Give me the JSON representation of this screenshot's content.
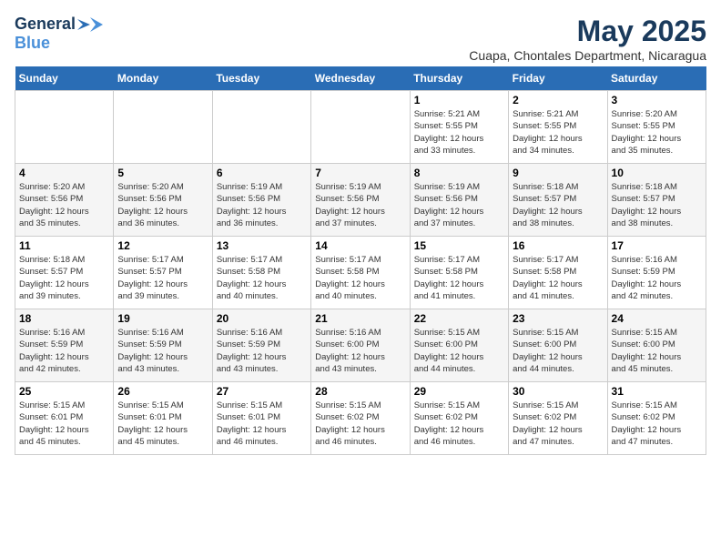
{
  "header": {
    "logo_general": "General",
    "logo_blue": "Blue",
    "month_title": "May 2025",
    "location": "Cuapa, Chontales Department, Nicaragua"
  },
  "days_of_week": [
    "Sunday",
    "Monday",
    "Tuesday",
    "Wednesday",
    "Thursday",
    "Friday",
    "Saturday"
  ],
  "weeks": [
    [
      {
        "day": "",
        "content": ""
      },
      {
        "day": "",
        "content": ""
      },
      {
        "day": "",
        "content": ""
      },
      {
        "day": "",
        "content": ""
      },
      {
        "day": "1",
        "content": "Sunrise: 5:21 AM\nSunset: 5:55 PM\nDaylight: 12 hours\nand 33 minutes."
      },
      {
        "day": "2",
        "content": "Sunrise: 5:21 AM\nSunset: 5:55 PM\nDaylight: 12 hours\nand 34 minutes."
      },
      {
        "day": "3",
        "content": "Sunrise: 5:20 AM\nSunset: 5:55 PM\nDaylight: 12 hours\nand 35 minutes."
      }
    ],
    [
      {
        "day": "4",
        "content": "Sunrise: 5:20 AM\nSunset: 5:56 PM\nDaylight: 12 hours\nand 35 minutes."
      },
      {
        "day": "5",
        "content": "Sunrise: 5:20 AM\nSunset: 5:56 PM\nDaylight: 12 hours\nand 36 minutes."
      },
      {
        "day": "6",
        "content": "Sunrise: 5:19 AM\nSunset: 5:56 PM\nDaylight: 12 hours\nand 36 minutes."
      },
      {
        "day": "7",
        "content": "Sunrise: 5:19 AM\nSunset: 5:56 PM\nDaylight: 12 hours\nand 37 minutes."
      },
      {
        "day": "8",
        "content": "Sunrise: 5:19 AM\nSunset: 5:56 PM\nDaylight: 12 hours\nand 37 minutes."
      },
      {
        "day": "9",
        "content": "Sunrise: 5:18 AM\nSunset: 5:57 PM\nDaylight: 12 hours\nand 38 minutes."
      },
      {
        "day": "10",
        "content": "Sunrise: 5:18 AM\nSunset: 5:57 PM\nDaylight: 12 hours\nand 38 minutes."
      }
    ],
    [
      {
        "day": "11",
        "content": "Sunrise: 5:18 AM\nSunset: 5:57 PM\nDaylight: 12 hours\nand 39 minutes."
      },
      {
        "day": "12",
        "content": "Sunrise: 5:17 AM\nSunset: 5:57 PM\nDaylight: 12 hours\nand 39 minutes."
      },
      {
        "day": "13",
        "content": "Sunrise: 5:17 AM\nSunset: 5:58 PM\nDaylight: 12 hours\nand 40 minutes."
      },
      {
        "day": "14",
        "content": "Sunrise: 5:17 AM\nSunset: 5:58 PM\nDaylight: 12 hours\nand 40 minutes."
      },
      {
        "day": "15",
        "content": "Sunrise: 5:17 AM\nSunset: 5:58 PM\nDaylight: 12 hours\nand 41 minutes."
      },
      {
        "day": "16",
        "content": "Sunrise: 5:17 AM\nSunset: 5:58 PM\nDaylight: 12 hours\nand 41 minutes."
      },
      {
        "day": "17",
        "content": "Sunrise: 5:16 AM\nSunset: 5:59 PM\nDaylight: 12 hours\nand 42 minutes."
      }
    ],
    [
      {
        "day": "18",
        "content": "Sunrise: 5:16 AM\nSunset: 5:59 PM\nDaylight: 12 hours\nand 42 minutes."
      },
      {
        "day": "19",
        "content": "Sunrise: 5:16 AM\nSunset: 5:59 PM\nDaylight: 12 hours\nand 43 minutes."
      },
      {
        "day": "20",
        "content": "Sunrise: 5:16 AM\nSunset: 5:59 PM\nDaylight: 12 hours\nand 43 minutes."
      },
      {
        "day": "21",
        "content": "Sunrise: 5:16 AM\nSunset: 6:00 PM\nDaylight: 12 hours\nand 43 minutes."
      },
      {
        "day": "22",
        "content": "Sunrise: 5:15 AM\nSunset: 6:00 PM\nDaylight: 12 hours\nand 44 minutes."
      },
      {
        "day": "23",
        "content": "Sunrise: 5:15 AM\nSunset: 6:00 PM\nDaylight: 12 hours\nand 44 minutes."
      },
      {
        "day": "24",
        "content": "Sunrise: 5:15 AM\nSunset: 6:00 PM\nDaylight: 12 hours\nand 45 minutes."
      }
    ],
    [
      {
        "day": "25",
        "content": "Sunrise: 5:15 AM\nSunset: 6:01 PM\nDaylight: 12 hours\nand 45 minutes."
      },
      {
        "day": "26",
        "content": "Sunrise: 5:15 AM\nSunset: 6:01 PM\nDaylight: 12 hours\nand 45 minutes."
      },
      {
        "day": "27",
        "content": "Sunrise: 5:15 AM\nSunset: 6:01 PM\nDaylight: 12 hours\nand 46 minutes."
      },
      {
        "day": "28",
        "content": "Sunrise: 5:15 AM\nSunset: 6:02 PM\nDaylight: 12 hours\nand 46 minutes."
      },
      {
        "day": "29",
        "content": "Sunrise: 5:15 AM\nSunset: 6:02 PM\nDaylight: 12 hours\nand 46 minutes."
      },
      {
        "day": "30",
        "content": "Sunrise: 5:15 AM\nSunset: 6:02 PM\nDaylight: 12 hours\nand 47 minutes."
      },
      {
        "day": "31",
        "content": "Sunrise: 5:15 AM\nSunset: 6:02 PM\nDaylight: 12 hours\nand 47 minutes."
      }
    ]
  ]
}
